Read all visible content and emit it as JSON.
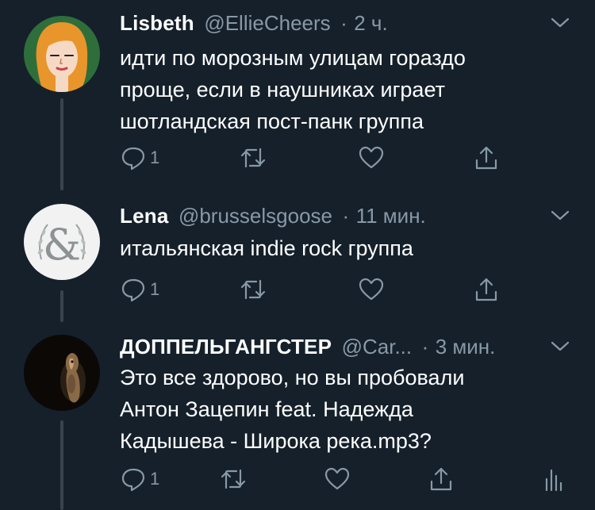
{
  "colors": {
    "background": "#15202b",
    "text_primary": "#ffffff",
    "text_secondary": "#8899a6",
    "thread_line": "#38444d"
  },
  "tweets": [
    {
      "name": "Lisbeth",
      "handle": "@EllieCheers",
      "dot": "·",
      "time": "2 ч.",
      "lines": [
        "идти по морозным улицам гораздо",
        "проще, если в наушниках играет",
        "шотландская пост-панк группа"
      ],
      "reply_count": "1",
      "avatar_icon": "red-haired-woman-illustration-avatar",
      "actions": [
        "reply-icon",
        "retweet-icon",
        "like-icon",
        "share-icon"
      ]
    },
    {
      "name": "Lena",
      "handle": "@brusselsgoose",
      "dot": "·",
      "time": "11 мин.",
      "lines": [
        "итальянская indie rock группа"
      ],
      "reply_count": "1",
      "avatar_icon": "ampersand-wreath-avatar",
      "actions": [
        "reply-icon",
        "retweet-icon",
        "like-icon",
        "share-icon"
      ]
    },
    {
      "name": "ДОППЕЛЬГАНГСТЕР",
      "handle": "@Car...",
      "dot": "·",
      "time": "3 мин.",
      "lines": [
        "Это все здорово, но вы пробовали",
        "Антон Зацепин feat. Надежда",
        "Кадышева - Широка река.mp3?"
      ],
      "reply_count": "1",
      "avatar_icon": "dog-in-dark-avatar",
      "actions": [
        "reply-icon",
        "retweet-icon",
        "like-icon",
        "share-icon",
        "analytics-icon"
      ]
    }
  ]
}
